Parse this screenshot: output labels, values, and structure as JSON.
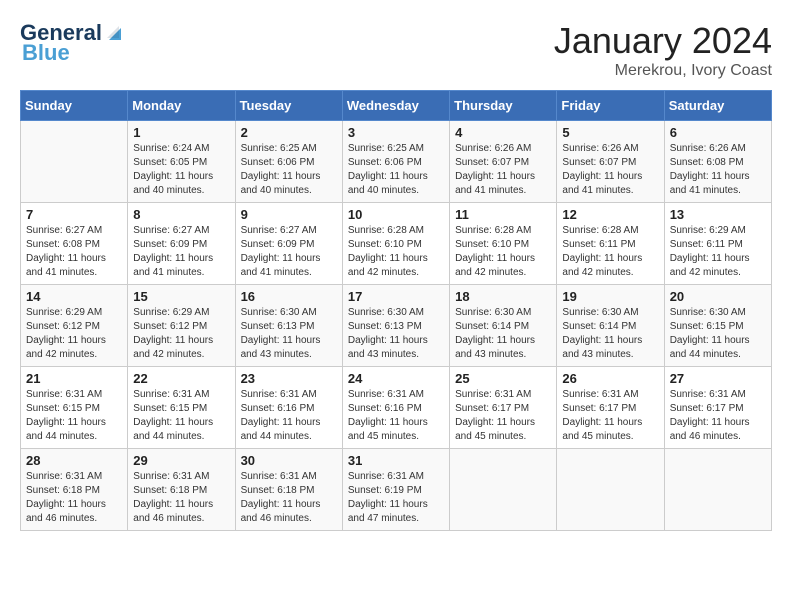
{
  "header": {
    "logo_general": "General",
    "logo_blue": "Blue",
    "month_title": "January 2024",
    "location": "Merekrou, Ivory Coast"
  },
  "weekdays": [
    "Sunday",
    "Monday",
    "Tuesday",
    "Wednesday",
    "Thursday",
    "Friday",
    "Saturday"
  ],
  "weeks": [
    [
      {
        "day": "",
        "sunrise": "",
        "sunset": "",
        "daylight": ""
      },
      {
        "day": "1",
        "sunrise": "Sunrise: 6:24 AM",
        "sunset": "Sunset: 6:05 PM",
        "daylight": "Daylight: 11 hours and 40 minutes."
      },
      {
        "day": "2",
        "sunrise": "Sunrise: 6:25 AM",
        "sunset": "Sunset: 6:06 PM",
        "daylight": "Daylight: 11 hours and 40 minutes."
      },
      {
        "day": "3",
        "sunrise": "Sunrise: 6:25 AM",
        "sunset": "Sunset: 6:06 PM",
        "daylight": "Daylight: 11 hours and 40 minutes."
      },
      {
        "day": "4",
        "sunrise": "Sunrise: 6:26 AM",
        "sunset": "Sunset: 6:07 PM",
        "daylight": "Daylight: 11 hours and 41 minutes."
      },
      {
        "day": "5",
        "sunrise": "Sunrise: 6:26 AM",
        "sunset": "Sunset: 6:07 PM",
        "daylight": "Daylight: 11 hours and 41 minutes."
      },
      {
        "day": "6",
        "sunrise": "Sunrise: 6:26 AM",
        "sunset": "Sunset: 6:08 PM",
        "daylight": "Daylight: 11 hours and 41 minutes."
      }
    ],
    [
      {
        "day": "7",
        "sunrise": "Sunrise: 6:27 AM",
        "sunset": "Sunset: 6:08 PM",
        "daylight": "Daylight: 11 hours and 41 minutes."
      },
      {
        "day": "8",
        "sunrise": "Sunrise: 6:27 AM",
        "sunset": "Sunset: 6:09 PM",
        "daylight": "Daylight: 11 hours and 41 minutes."
      },
      {
        "day": "9",
        "sunrise": "Sunrise: 6:27 AM",
        "sunset": "Sunset: 6:09 PM",
        "daylight": "Daylight: 11 hours and 41 minutes."
      },
      {
        "day": "10",
        "sunrise": "Sunrise: 6:28 AM",
        "sunset": "Sunset: 6:10 PM",
        "daylight": "Daylight: 11 hours and 42 minutes."
      },
      {
        "day": "11",
        "sunrise": "Sunrise: 6:28 AM",
        "sunset": "Sunset: 6:10 PM",
        "daylight": "Daylight: 11 hours and 42 minutes."
      },
      {
        "day": "12",
        "sunrise": "Sunrise: 6:28 AM",
        "sunset": "Sunset: 6:11 PM",
        "daylight": "Daylight: 11 hours and 42 minutes."
      },
      {
        "day": "13",
        "sunrise": "Sunrise: 6:29 AM",
        "sunset": "Sunset: 6:11 PM",
        "daylight": "Daylight: 11 hours and 42 minutes."
      }
    ],
    [
      {
        "day": "14",
        "sunrise": "Sunrise: 6:29 AM",
        "sunset": "Sunset: 6:12 PM",
        "daylight": "Daylight: 11 hours and 42 minutes."
      },
      {
        "day": "15",
        "sunrise": "Sunrise: 6:29 AM",
        "sunset": "Sunset: 6:12 PM",
        "daylight": "Daylight: 11 hours and 42 minutes."
      },
      {
        "day": "16",
        "sunrise": "Sunrise: 6:30 AM",
        "sunset": "Sunset: 6:13 PM",
        "daylight": "Daylight: 11 hours and 43 minutes."
      },
      {
        "day": "17",
        "sunrise": "Sunrise: 6:30 AM",
        "sunset": "Sunset: 6:13 PM",
        "daylight": "Daylight: 11 hours and 43 minutes."
      },
      {
        "day": "18",
        "sunrise": "Sunrise: 6:30 AM",
        "sunset": "Sunset: 6:14 PM",
        "daylight": "Daylight: 11 hours and 43 minutes."
      },
      {
        "day": "19",
        "sunrise": "Sunrise: 6:30 AM",
        "sunset": "Sunset: 6:14 PM",
        "daylight": "Daylight: 11 hours and 43 minutes."
      },
      {
        "day": "20",
        "sunrise": "Sunrise: 6:30 AM",
        "sunset": "Sunset: 6:15 PM",
        "daylight": "Daylight: 11 hours and 44 minutes."
      }
    ],
    [
      {
        "day": "21",
        "sunrise": "Sunrise: 6:31 AM",
        "sunset": "Sunset: 6:15 PM",
        "daylight": "Daylight: 11 hours and 44 minutes."
      },
      {
        "day": "22",
        "sunrise": "Sunrise: 6:31 AM",
        "sunset": "Sunset: 6:15 PM",
        "daylight": "Daylight: 11 hours and 44 minutes."
      },
      {
        "day": "23",
        "sunrise": "Sunrise: 6:31 AM",
        "sunset": "Sunset: 6:16 PM",
        "daylight": "Daylight: 11 hours and 44 minutes."
      },
      {
        "day": "24",
        "sunrise": "Sunrise: 6:31 AM",
        "sunset": "Sunset: 6:16 PM",
        "daylight": "Daylight: 11 hours and 45 minutes."
      },
      {
        "day": "25",
        "sunrise": "Sunrise: 6:31 AM",
        "sunset": "Sunset: 6:17 PM",
        "daylight": "Daylight: 11 hours and 45 minutes."
      },
      {
        "day": "26",
        "sunrise": "Sunrise: 6:31 AM",
        "sunset": "Sunset: 6:17 PM",
        "daylight": "Daylight: 11 hours and 45 minutes."
      },
      {
        "day": "27",
        "sunrise": "Sunrise: 6:31 AM",
        "sunset": "Sunset: 6:17 PM",
        "daylight": "Daylight: 11 hours and 46 minutes."
      }
    ],
    [
      {
        "day": "28",
        "sunrise": "Sunrise: 6:31 AM",
        "sunset": "Sunset: 6:18 PM",
        "daylight": "Daylight: 11 hours and 46 minutes."
      },
      {
        "day": "29",
        "sunrise": "Sunrise: 6:31 AM",
        "sunset": "Sunset: 6:18 PM",
        "daylight": "Daylight: 11 hours and 46 minutes."
      },
      {
        "day": "30",
        "sunrise": "Sunrise: 6:31 AM",
        "sunset": "Sunset: 6:18 PM",
        "daylight": "Daylight: 11 hours and 46 minutes."
      },
      {
        "day": "31",
        "sunrise": "Sunrise: 6:31 AM",
        "sunset": "Sunset: 6:19 PM",
        "daylight": "Daylight: 11 hours and 47 minutes."
      },
      {
        "day": "",
        "sunrise": "",
        "sunset": "",
        "daylight": ""
      },
      {
        "day": "",
        "sunrise": "",
        "sunset": "",
        "daylight": ""
      },
      {
        "day": "",
        "sunrise": "",
        "sunset": "",
        "daylight": ""
      }
    ]
  ]
}
